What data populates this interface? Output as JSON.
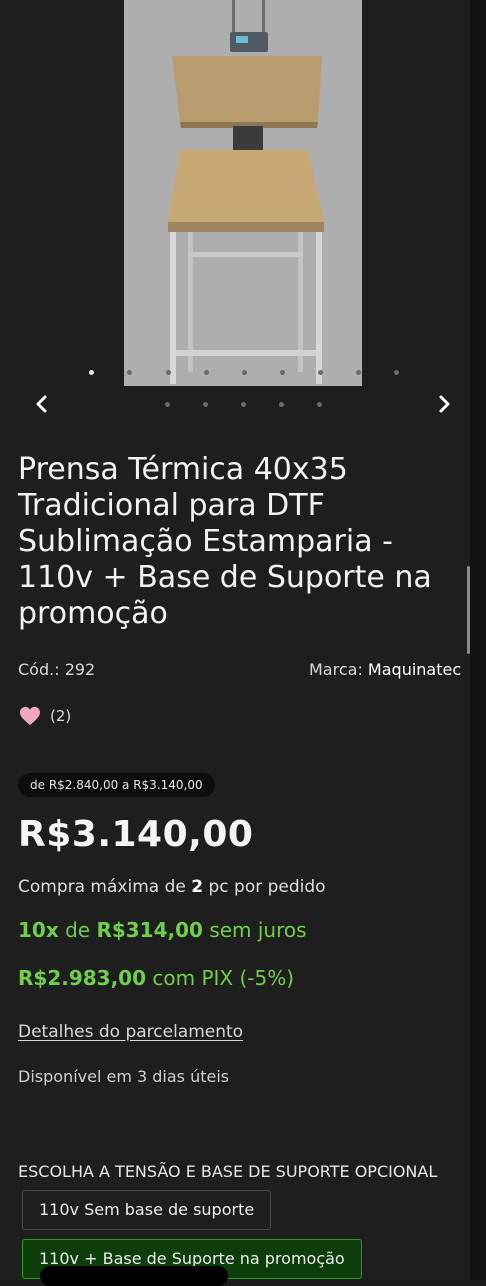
{
  "gallery": {
    "image_alt": "Prensa térmica com base de suporte",
    "image_dots": 9,
    "active_image_dot": 0,
    "page_dots": 5,
    "prev_icon": "chevron-left-icon",
    "next_icon": "chevron-right-icon"
  },
  "product": {
    "title": "Prensa Térmica 40x35 Tradicional para DTF Sublimação Estamparia - 110v + Base de Suporte na promoção",
    "code_label": "Cód.:",
    "code": "292",
    "brand_label": "Marca:",
    "brand": "Maquinatec",
    "favorites_icon": "heart-icon",
    "favorites_count": "(2)"
  },
  "pricing": {
    "old_price_range": "de R$2.840,00 a R$3.140,00",
    "price": "R$3.140,00",
    "max_purchase_prefix": "Compra máxima de",
    "max_purchase_qty": "2",
    "max_purchase_suffix": "pc por pedido",
    "installments_count": "10x",
    "installments_de": "de",
    "installments_value": "R$314,00",
    "installments_suffix": "sem juros",
    "pix_price": "R$2.983,00",
    "pix_suffix": "com PIX (-5%)",
    "installment_details_link": "Detalhes do parcelamento",
    "availability": "Disponível em 3 dias úteis"
  },
  "options": {
    "label": "ESCOLHA A TENSÃO E BASE DE SUPORTE OPCIONAL",
    "items": [
      {
        "label": "110v Sem base de suporte",
        "selected": false
      },
      {
        "label": "110v + Base de Suporte na promoção",
        "selected": true
      }
    ]
  },
  "colors": {
    "accent_green": "#6fcf4a",
    "selected_option_bg": "#0e3d0c",
    "heart": "#f2a7c0"
  }
}
